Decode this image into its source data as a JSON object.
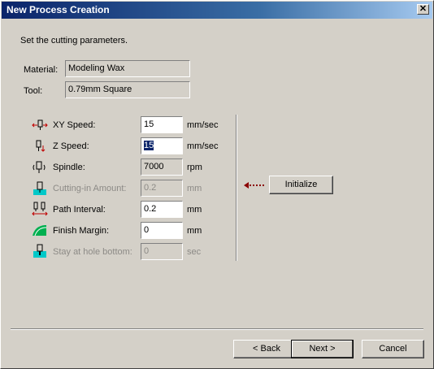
{
  "window": {
    "title": "New Process Creation",
    "close_label": "✕"
  },
  "intro": "Set the cutting parameters.",
  "material": {
    "label": "Material:",
    "value": "Modeling Wax"
  },
  "tool": {
    "label": "Tool:",
    "value": "0.79mm Square"
  },
  "params": {
    "xy_speed": {
      "label": "XY Speed:",
      "value": "15",
      "unit": "mm/sec",
      "enabled": true,
      "icon": "xy-speed-icon"
    },
    "z_speed": {
      "label": "Z Speed:",
      "value": "15",
      "unit": "mm/sec",
      "enabled": true,
      "selected": true,
      "icon": "z-speed-icon"
    },
    "spindle": {
      "label": "Spindle:",
      "value": "7000",
      "unit": "rpm",
      "enabled": false,
      "icon": "spindle-icon"
    },
    "cutting_in": {
      "label": "Cutting-in Amount:",
      "value": "0.2",
      "unit": "mm",
      "enabled": false,
      "icon": "cutting-in-icon"
    },
    "path_interval": {
      "label": "Path Interval:",
      "value": "0.2",
      "unit": "mm",
      "enabled": true,
      "icon": "path-interval-icon"
    },
    "finish_margin": {
      "label": "Finish Margin:",
      "value": "0",
      "unit": "mm",
      "enabled": true,
      "icon": "finish-margin-icon"
    },
    "stay_bottom": {
      "label": "Stay at hole bottom:",
      "value": "0",
      "unit": "sec",
      "enabled": false,
      "icon": "stay-bottom-icon"
    }
  },
  "initialize": {
    "label": "Initialize",
    "arrow_icon": "left-dotted-arrow-icon"
  },
  "footer": {
    "back": "< Back",
    "next": "Next >",
    "cancel": "Cancel"
  },
  "colors": {
    "title_start": "#0a246a",
    "title_end": "#a6caf0",
    "face": "#d4d0c8",
    "selection": "#0a246a",
    "arrow": "#8b0000",
    "icon_cyan": "#00c8c8"
  }
}
